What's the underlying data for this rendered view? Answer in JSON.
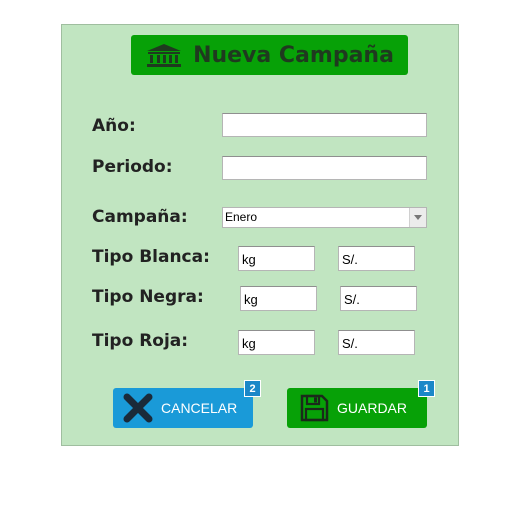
{
  "header": {
    "title": "Nueva Campaña",
    "icon": "bank-icon"
  },
  "form": {
    "anio_label": "Año:",
    "anio_value": "",
    "periodo_label": "Periodo:",
    "periodo_value": "",
    "campana_label": "Campaña:",
    "campana_selected": "Enero",
    "blanca_label": "Tipo Blanca:",
    "blanca_kg": "kg",
    "blanca_soles": "S/.",
    "negra_label": "Tipo Negra:",
    "negra_kg": "kg",
    "negra_soles": "S/.",
    "roja_label": "Tipo Roja:",
    "roja_kg": "kg",
    "roja_soles": "S/."
  },
  "buttons": {
    "cancel_label": "CANCELAR",
    "cancel_badge": "2",
    "cancel_icon": "close-icon",
    "save_label": "GUARDAR",
    "save_badge": "1",
    "save_icon": "floppy-disk-icon"
  },
  "colors": {
    "panel_bg": "#c1e5c1",
    "primary_green": "#07a107",
    "cancel_blue": "#1a9ad8",
    "badge_blue": "#1b87c8"
  }
}
